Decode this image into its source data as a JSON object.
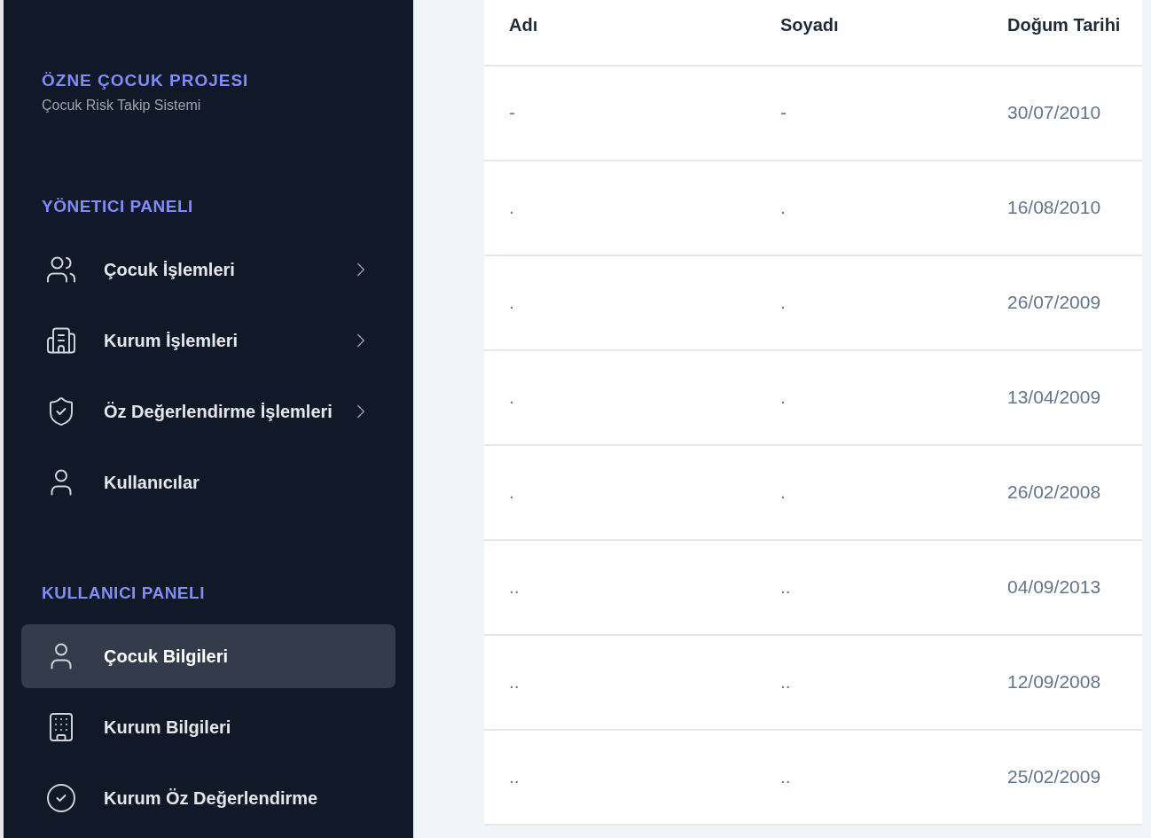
{
  "sidebar": {
    "brand": {
      "title": "ÖZNE ÇOCUK PROJESI",
      "subtitle": "Çocuk Risk Takip Sistemi"
    },
    "sections": [
      {
        "heading": "YÖNETICI PANELI",
        "items": [
          {
            "label": "Çocuk İşlemleri",
            "kind": "users",
            "has_submenu": true,
            "selected": false
          },
          {
            "label": "Kurum İşlemleri",
            "kind": "buildings",
            "has_submenu": true,
            "selected": false
          },
          {
            "label": "Öz Değerlendirme İşlemleri",
            "kind": "shield",
            "has_submenu": true,
            "selected": false
          },
          {
            "label": "Kullanıcılar",
            "kind": "user",
            "has_submenu": false,
            "selected": false
          }
        ]
      },
      {
        "heading": "KULLANICI PANELI",
        "items": [
          {
            "label": "Çocuk Bilgileri",
            "kind": "user",
            "has_submenu": false,
            "selected": true
          },
          {
            "label": "Kurum Bilgileri",
            "kind": "building",
            "has_submenu": false,
            "selected": false
          },
          {
            "label": "Kurum Öz Değerlendirme",
            "kind": "check",
            "has_submenu": false,
            "selected": false
          }
        ]
      }
    ]
  },
  "table": {
    "columns": [
      "Adı",
      "Soyadı",
      "Doğum Tarihi"
    ],
    "rows": [
      [
        "-",
        "-",
        "30/07/2010"
      ],
      [
        ".",
        ".",
        "16/08/2010"
      ],
      [
        ".",
        ".",
        "26/07/2009"
      ],
      [
        ".",
        ".",
        "13/04/2009"
      ],
      [
        ".",
        ".",
        "26/02/2008"
      ],
      [
        "..",
        "..",
        "04/09/2013"
      ],
      [
        "..",
        "..",
        "12/09/2008"
      ],
      [
        "..",
        "..",
        "25/02/2009"
      ]
    ]
  }
}
